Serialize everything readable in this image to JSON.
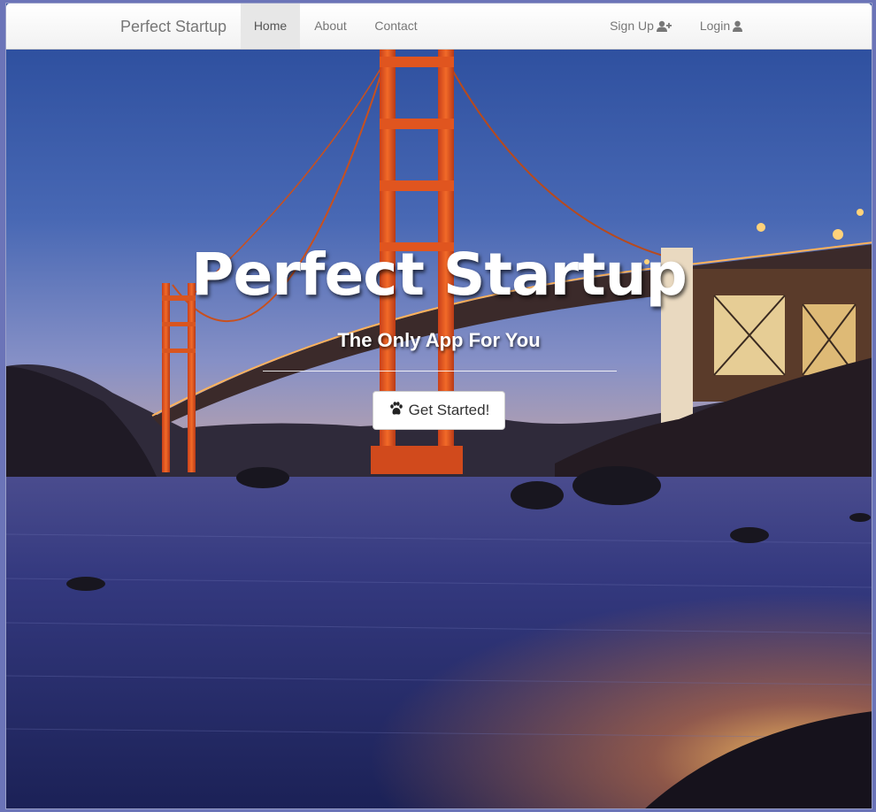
{
  "navbar": {
    "brand": "Perfect Startup",
    "items": [
      {
        "label": "Home",
        "active": true
      },
      {
        "label": "About",
        "active": false
      },
      {
        "label": "Contact",
        "active": false
      }
    ],
    "right_items": [
      {
        "label": "Sign Up",
        "icon": "user-plus-icon"
      },
      {
        "label": "Login",
        "icon": "user-icon"
      }
    ]
  },
  "hero": {
    "title": "Perfect Startup",
    "subtitle": "The Only App For You",
    "button_label": "Get Started!",
    "button_icon": "paw-icon",
    "background": "photo of the Golden Gate Bridge at dusk from the beach"
  },
  "colors": {
    "bridge": "#e0551f",
    "sky_top": "#2c4e9e",
    "sky_bottom": "#9aa3c9",
    "water": "#2a3478",
    "lights": "#ffc058",
    "navbar_bg": "#f8f8f8",
    "nav_active_bg": "#e7e7e7"
  }
}
